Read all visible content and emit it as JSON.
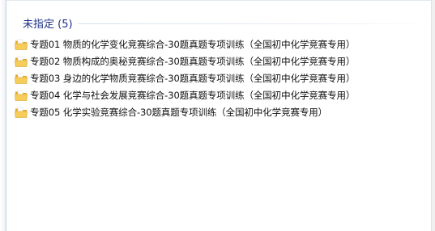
{
  "group": {
    "title": "未指定 (5)"
  },
  "items": [
    {
      "label": "专题01 物质的化学变化竞赛综合-30题真题专项训练（全国初中化学竞赛专用）",
      "icon": "folder-icon"
    },
    {
      "label": "专题02 物质构成的奥秘竞赛综合-30题真题专项训练（全国初中化学竞赛专用）",
      "icon": "folder-icon"
    },
    {
      "label": "专题03 身边的化学物质竞赛综合-30题真题专项训练（全国初中化学竞赛专用）",
      "icon": "folder-icon"
    },
    {
      "label": "专题04 化学与社会发展竞赛综合-30题真题专项训练（全国初中化学竞赛专用）",
      "icon": "folder-icon"
    },
    {
      "label": "专题05 化学实验竞赛综合-30题真题专项训练（全国初中化学竞赛专用）",
      "icon": "folder-icon"
    }
  ],
  "colors": {
    "group_title": "#1e3287",
    "folder_body": "#f5c44a",
    "folder_tab": "#e0a526"
  }
}
